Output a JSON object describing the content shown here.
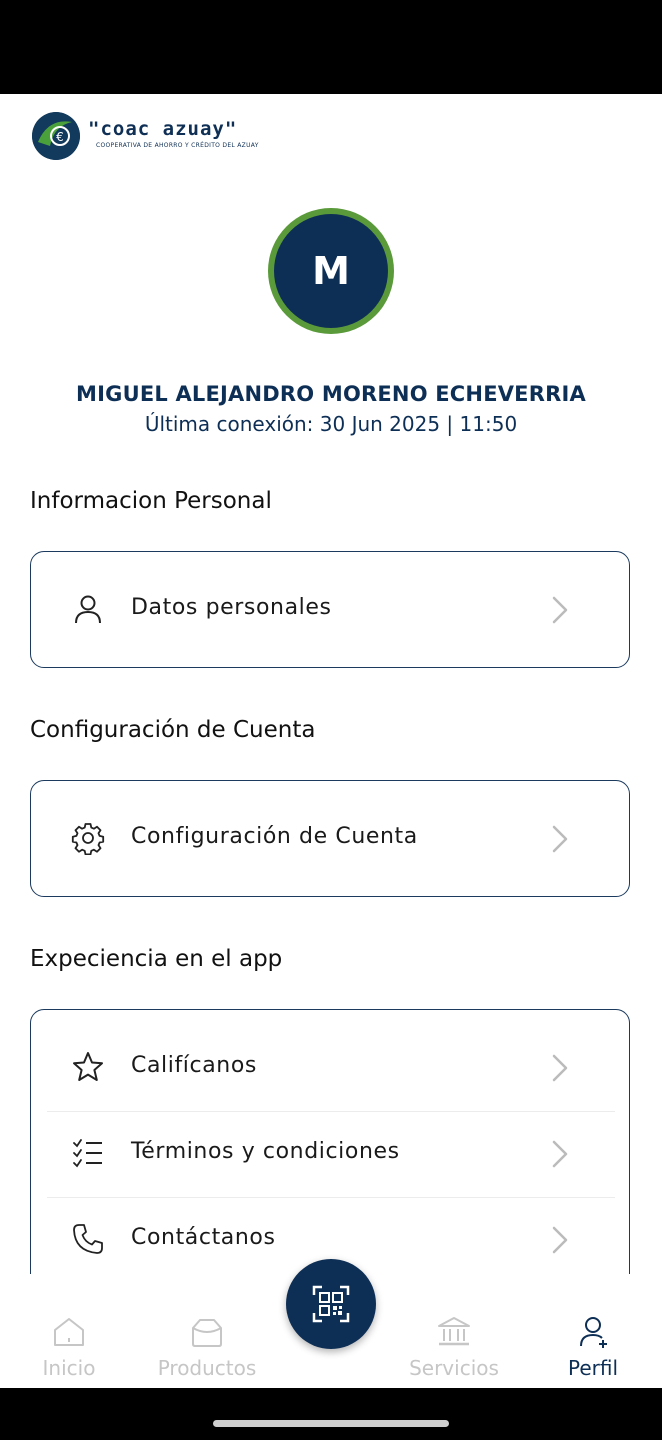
{
  "brand": {
    "logo_text": "\"coac azuay\"",
    "logo_subtitle": "COOPERATIVA DE AHORRO Y CRÉDITO DEL AZUAY"
  },
  "profile": {
    "initial": "M",
    "name": "MIGUEL ALEJANDRO MORENO ECHEVERRIA",
    "last_connection": "Última conexión: 30 Jun 2025 | 11:50"
  },
  "sections": {
    "personal": {
      "title": "Informacion Personal",
      "items": [
        {
          "label": "Datos personales",
          "icon": "person-icon"
        }
      ]
    },
    "account": {
      "title": "Configuración de Cuenta",
      "items": [
        {
          "label": "Configuración de Cuenta",
          "icon": "gear-icon"
        }
      ]
    },
    "experience": {
      "title": "Expeciencia en el app",
      "items": [
        {
          "label": "Califícanos",
          "icon": "star-icon"
        },
        {
          "label": "Términos y condiciones",
          "icon": "checklist-icon"
        },
        {
          "label": "Contáctanos",
          "icon": "phone-icon"
        }
      ]
    }
  },
  "bottom_nav": {
    "tabs": [
      {
        "label": "Inicio",
        "icon": "home-icon",
        "active": false
      },
      {
        "label": "Productos",
        "icon": "bag-icon",
        "active": false
      },
      {
        "label": "Servicios",
        "icon": "bank-icon",
        "active": false
      },
      {
        "label": "Perfil",
        "icon": "user-add-icon",
        "active": true
      }
    ],
    "fab_icon": "qr-scan-icon"
  },
  "colors": {
    "primary": "#0e2f55",
    "accent_green": "#5a9a3a",
    "inactive": "#c6c6c6"
  }
}
